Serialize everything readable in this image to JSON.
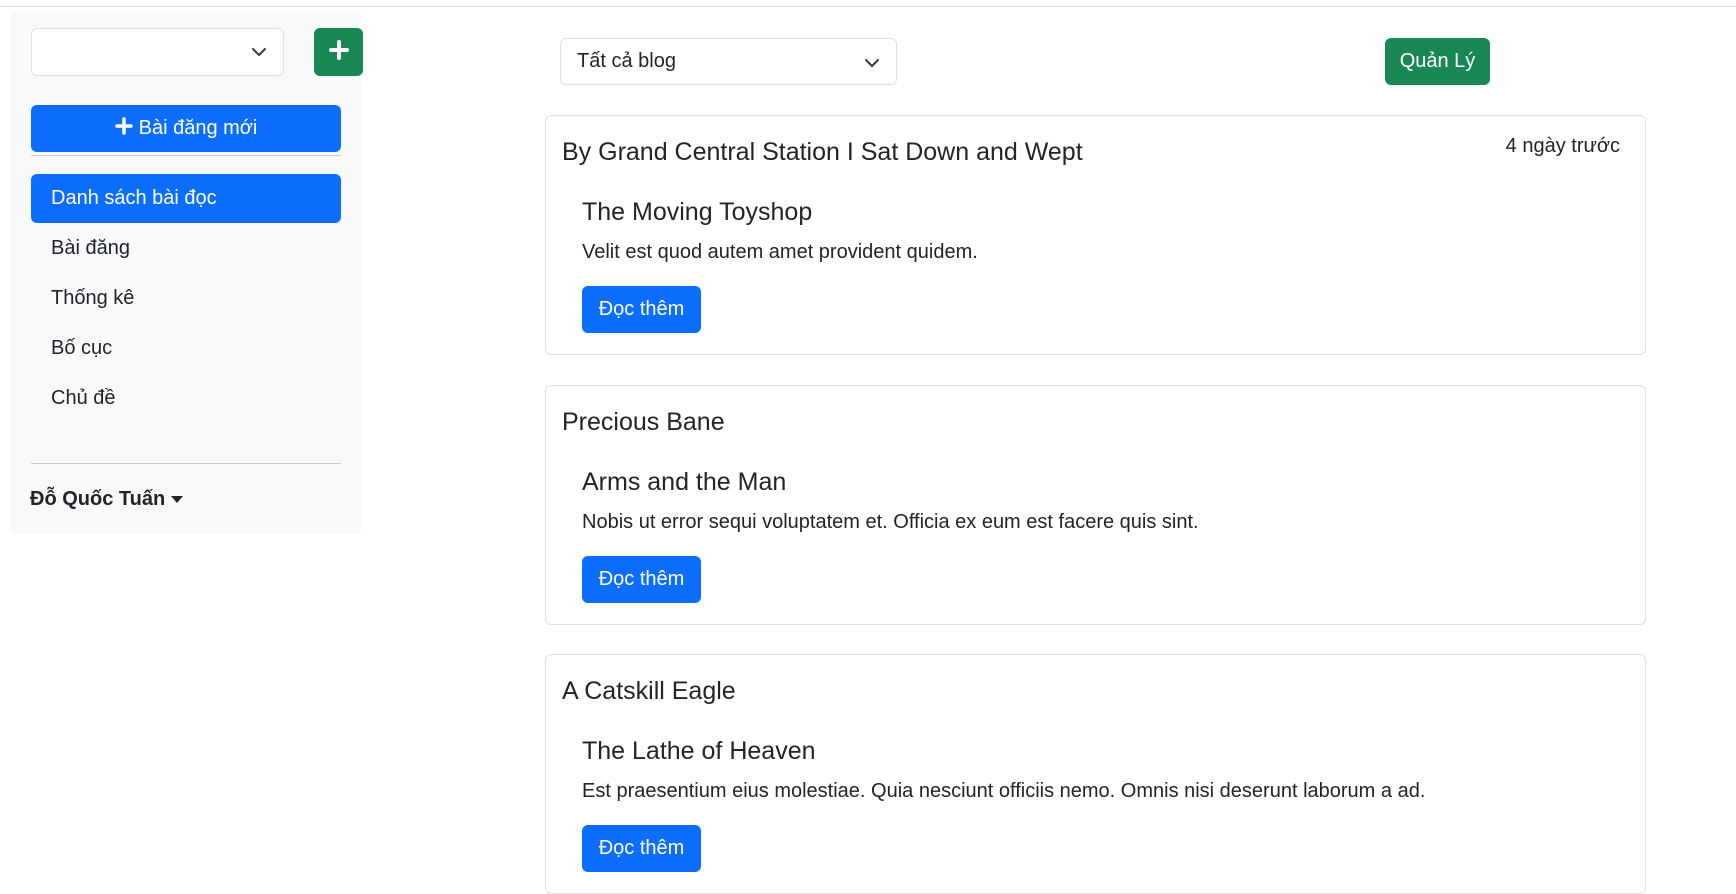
{
  "sidebar": {
    "blog_select_value": "",
    "new_post_label": "Bài đăng mới",
    "items": [
      {
        "label": "Danh sách bài đọc",
        "active": true
      },
      {
        "label": "Bài đăng",
        "active": false
      },
      {
        "label": "Thống kê",
        "active": false
      },
      {
        "label": "Bố cục",
        "active": false
      },
      {
        "label": "Chủ đề",
        "active": false
      }
    ],
    "user_name": "Đỗ Quốc Tuấn"
  },
  "main": {
    "filter_select_value": "Tất cả blog",
    "manage_label": "Quản Lý",
    "posts": [
      {
        "blog_name": "By Grand Central Station I Sat Down and Wept",
        "time": "4 ngày trước",
        "title": "The Moving Toyshop",
        "excerpt": "Velit est quod autem amet provident quidem.",
        "read_more": "Đọc thêm"
      },
      {
        "blog_name": "Precious Bane",
        "time": "",
        "title": "Arms and the Man",
        "excerpt": "Nobis ut error sequi voluptatem et. Officia ex eum est facere quis sint.",
        "read_more": "Đọc thêm"
      },
      {
        "blog_name": "A Catskill Eagle",
        "time": "",
        "title": "The Lathe of Heaven",
        "excerpt": "Est praesentium eius molestiae. Quia nesciunt officiis nemo. Omnis nisi deserunt laborum a ad.",
        "read_more": "Đọc thêm"
      }
    ]
  },
  "colors": {
    "primary": "#0d6efd",
    "success": "#198754",
    "sidebar_bg": "#f8f9fa",
    "border": "#dee2e6"
  },
  "icons": {
    "dropdown": "chevron-down-icon",
    "add": "plus-icon",
    "user_menu": "caret-down-icon"
  }
}
